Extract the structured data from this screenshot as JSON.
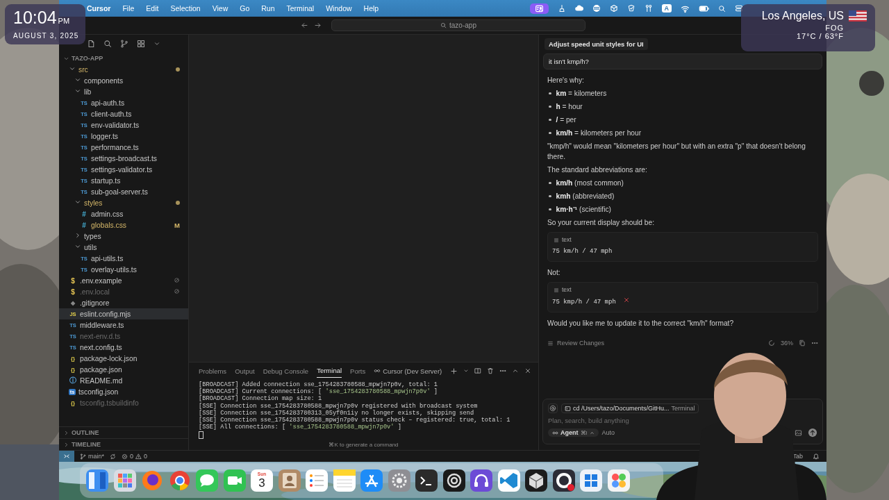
{
  "clock": {
    "time": "10:04",
    "period": "PM",
    "date": "AUGUST 3, 2025"
  },
  "weather": {
    "city": "Los Angeles, US",
    "condition": "FOG",
    "temperature": "17°C / 63°F"
  },
  "menubar": {
    "items": [
      "Cursor",
      "File",
      "Edit",
      "Selection",
      "View",
      "Go",
      "Run",
      "Terminal",
      "Window",
      "Help"
    ],
    "input_source": "A"
  },
  "titlebar": {
    "search": "tazo-app"
  },
  "sidebar": {
    "project": "TAZO-APP",
    "tree": [
      {
        "name": "src",
        "kind": "folder",
        "expanded": true,
        "modified": true,
        "changed": true,
        "selected": false,
        "children": [
          {
            "name": "components",
            "kind": "folder",
            "expanded": true,
            "selected": false
          },
          {
            "name": "lib",
            "kind": "folder",
            "expanded": true,
            "selected": false,
            "children": [
              {
                "name": "api-auth.ts",
                "kind": "ts",
                "icon": "TS",
                "selected": false
              },
              {
                "name": "client-auth.ts",
                "kind": "ts",
                "icon": "TS",
                "selected": false
              },
              {
                "name": "env-validator.ts",
                "kind": "ts",
                "icon": "TS",
                "selected": false
              },
              {
                "name": "logger.ts",
                "kind": "ts",
                "icon": "TS",
                "selected": false
              },
              {
                "name": "performance.ts",
                "kind": "ts",
                "icon": "TS",
                "selected": false
              },
              {
                "name": "settings-broadcast.ts",
                "kind": "ts",
                "icon": "TS",
                "selected": false
              },
              {
                "name": "settings-validator.ts",
                "kind": "ts",
                "icon": "TS",
                "selected": false
              },
              {
                "name": "startup.ts",
                "kind": "ts",
                "icon": "TS",
                "selected": false
              },
              {
                "name": "sub-goal-server.ts",
                "kind": "ts",
                "icon": "TS",
                "selected": false
              }
            ]
          },
          {
            "name": "styles",
            "kind": "folder",
            "expanded": true,
            "modified": true,
            "changed": true,
            "selected": false,
            "children": [
              {
                "name": "admin.css",
                "kind": "css",
                "icon": "#",
                "selected": false
              },
              {
                "name": "globals.css",
                "kind": "css",
                "icon": "#",
                "modified": true,
                "badge": "M",
                "selected": false
              }
            ]
          },
          {
            "name": "types",
            "kind": "folder",
            "expanded": false,
            "selected": false
          },
          {
            "name": "utils",
            "kind": "folder",
            "expanded": true,
            "selected": false,
            "children": [
              {
                "name": "api-utils.ts",
                "kind": "ts",
                "icon": "TS",
                "selected": false
              },
              {
                "name": "overlay-utils.ts",
                "kind": "ts",
                "icon": "TS",
                "selected": false
              }
            ]
          }
        ]
      },
      {
        "name": ".env.example",
        "kind": "env",
        "icon": "$",
        "ignored": true,
        "selected": false
      },
      {
        "name": ".env.local",
        "kind": "env",
        "icon": "$",
        "ignored": true,
        "dimmed": true,
        "selected": false
      },
      {
        "name": ".gitignore",
        "kind": "git",
        "icon": "◆",
        "selected": false
      },
      {
        "name": "eslint.config.mjs",
        "kind": "js",
        "icon": "JS",
        "selected": true
      },
      {
        "name": "middleware.ts",
        "kind": "ts",
        "icon": "TS",
        "selected": false
      },
      {
        "name": "next-env.d.ts",
        "kind": "ts",
        "icon": "TS",
        "dimmed": true,
        "selected": false
      },
      {
        "name": "next.config.ts",
        "kind": "ts",
        "icon": "TS",
        "selected": false
      },
      {
        "name": "package-lock.json",
        "kind": "json",
        "icon": "{}",
        "selected": false
      },
      {
        "name": "package.json",
        "kind": "json",
        "icon": "{}",
        "selected": false
      },
      {
        "name": "README.md",
        "kind": "info",
        "icon": "ⓘ",
        "selected": false
      },
      {
        "name": "tsconfig.json",
        "kind": "tsconfig",
        "icon": "ts",
        "selected": false
      },
      {
        "name": "tsconfig.tsbuildinfo",
        "kind": "json",
        "icon": "{}",
        "dimmed": true,
        "selected": false
      }
    ],
    "sections": [
      "OUTLINE",
      "TIMELINE"
    ]
  },
  "terminal": {
    "tabs": [
      {
        "label": "Problems",
        "selected": false
      },
      {
        "label": "Output",
        "selected": false
      },
      {
        "label": "Debug Console",
        "selected": false
      },
      {
        "label": "Terminal",
        "selected": true
      },
      {
        "label": "Ports",
        "selected": false
      }
    ],
    "session": "Cursor (Dev Server)",
    "lines": [
      [
        {
          "text": "[BROADCAST] Added connection sse_1754283780588_mpwjn7p0v, total: 1",
          "kind": "plain"
        }
      ],
      [
        {
          "text": "[BROADCAST] Current connections: [ ",
          "kind": "plain"
        },
        {
          "text": "'sse_1754283780588_mpwjn7p0v'",
          "kind": "string"
        },
        {
          "text": " ]",
          "kind": "plain"
        }
      ],
      [
        {
          "text": "[BROADCAST] Connection map size: 1",
          "kind": "plain"
        }
      ],
      [
        {
          "text": "[SSE] Connection sse_1754283780588_mpwjn7p0v registered with broadcast system",
          "kind": "plain"
        }
      ],
      [
        {
          "text": "[SSE] Connection sse_1754283780313_05yf0n1iy no longer exists, skipping send",
          "kind": "plain"
        }
      ],
      [
        {
          "text": "[SSE] Connection sse_1754283780588_mpwjn7p0v status check – registered: true, total: 1",
          "kind": "plain"
        }
      ],
      [
        {
          "text": "[SSE] All connections: [ ",
          "kind": "plain"
        },
        {
          "text": "'sse_1754283780588_mpwjn7p0v'",
          "kind": "string"
        },
        {
          "text": " ]",
          "kind": "plain"
        }
      ]
    ],
    "hint": "⌘K to generate a command"
  },
  "chat": {
    "title": "Adjust speed unit styles for UI",
    "user_message": "it isn't kmp/h?",
    "blocks": [
      {
        "kind": "paragraph",
        "text": "Here's why:"
      },
      {
        "kind": "bullets",
        "items": [
          "**km** = kilometers",
          "**h** = hour",
          "**/** = per",
          "**km/h** = kilometers per hour"
        ]
      },
      {
        "kind": "paragraph",
        "text": "\"kmp/h\" would mean \"kilometers per hour\" but with an extra \"p\" that doesn't belong there."
      },
      {
        "kind": "paragraph",
        "text": "The standard abbreviations are:"
      },
      {
        "kind": "bullets",
        "items": [
          "**km/h** (most common)",
          "**kmh** (abbreviated)",
          "**km·h⁻¹** (scientific)"
        ]
      },
      {
        "kind": "paragraph",
        "text": "So your current display should be:"
      },
      {
        "kind": "code",
        "language": "text",
        "code": "75 km/h / 47 mph",
        "error": false
      },
      {
        "kind": "paragraph",
        "text": "Not:"
      },
      {
        "kind": "code",
        "language": "text",
        "code": "75 kmp/h / 47 mph",
        "error": true
      },
      {
        "kind": "paragraph",
        "text": "Would you like me to update it to the correct \"km/h\" format?"
      }
    ],
    "review": {
      "label": "Review Changes",
      "progress": "36%"
    },
    "input": {
      "context": "cd /Users/tazo/Documents/GitHu...",
      "context_type": "Terminal",
      "placeholder": "Plan, search, build anything",
      "mode": "Agent",
      "mode_shortcut": "⌘I",
      "model": "Auto"
    }
  },
  "status_bar": {
    "branch": "main*",
    "errors": "0",
    "warnings": "0",
    "right": "Tab"
  },
  "dock": {
    "calendar_weekday": "Sun",
    "calendar_day": "3"
  }
}
